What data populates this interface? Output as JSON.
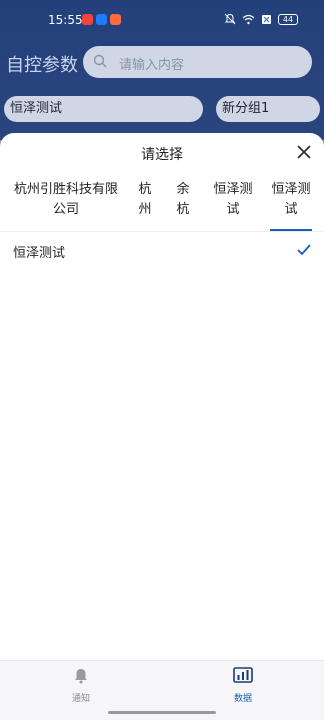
{
  "status_bar": {
    "time": "15:55",
    "battery": "44",
    "app_colors": [
      "#f04438",
      "#1f7aff",
      "#ff6b3d"
    ]
  },
  "header": {
    "title": "自控参数",
    "search_placeholder": "请输入内容",
    "left_select": "恒泽测试",
    "right_select": "新分组1"
  },
  "sheet": {
    "title": "请选择",
    "tabs": [
      {
        "label": "杭州引胜科技有限\n公司"
      },
      {
        "label": "杭\n州"
      },
      {
        "label": "余\n杭"
      },
      {
        "label": "恒泽测\n试"
      },
      {
        "label": "恒泽测\n试"
      }
    ],
    "active_tab_index": 4,
    "options": [
      {
        "label": "恒泽测试",
        "selected": true
      }
    ]
  },
  "bottom_nav": {
    "items": [
      {
        "label": "通知",
        "icon": "bell-icon",
        "active": false
      },
      {
        "label": "数据",
        "icon": "bar-chart-icon",
        "active": true
      }
    ]
  },
  "colors": {
    "accent": "#1a5fb4",
    "header_blue": "#4a78d9",
    "inactive_nav": "#8a8a8a"
  }
}
